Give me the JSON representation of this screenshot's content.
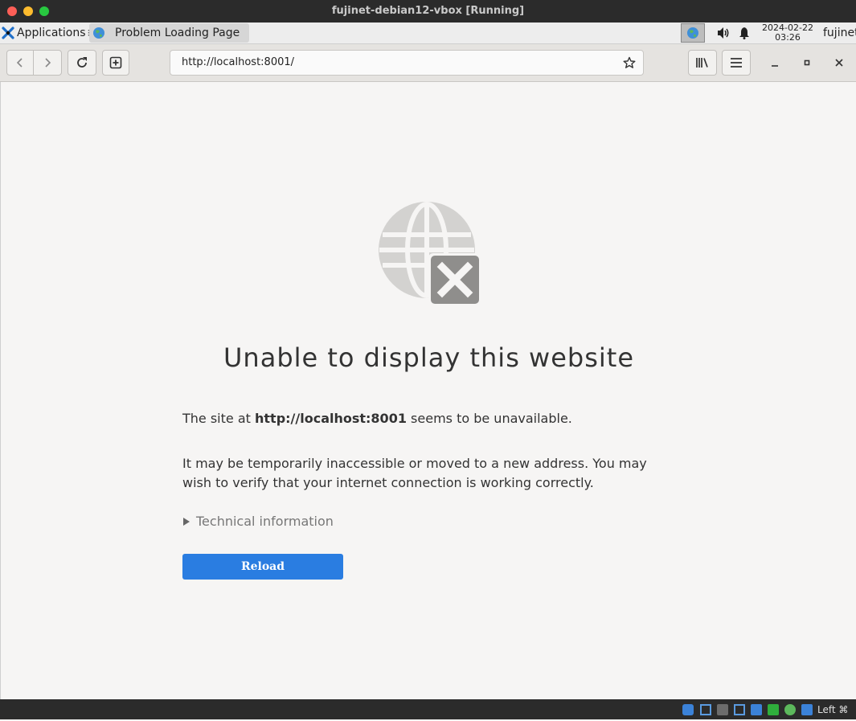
{
  "window": {
    "title": "fujinet-debian12-vbox [Running]"
  },
  "panel": {
    "applications_label": "Applications",
    "task_label": "Problem Loading Page",
    "clock_date": "2024-02-22",
    "clock_time": "03:26",
    "user": "fujinet"
  },
  "browser": {
    "url": "http://localhost:8001/"
  },
  "error_page": {
    "heading": "Unable to display this website",
    "line1_prefix": "The site at ",
    "line1_host": "http://localhost:8001",
    "line1_suffix": " seems to be unavailable.",
    "line2": "It may be temporarily inaccessible or moved to a new address. You may wish to verify that your internet connection is working correctly.",
    "technical_info": "Technical information",
    "reload_label": "Reload"
  },
  "statusbar": {
    "host_key": "Left ⌘"
  },
  "colors": {
    "accent": "#2a7de1",
    "titlebar": "#2b2b2b",
    "close": "#fe5f57",
    "minimize": "#febc2e",
    "maximize": "#28c840"
  }
}
